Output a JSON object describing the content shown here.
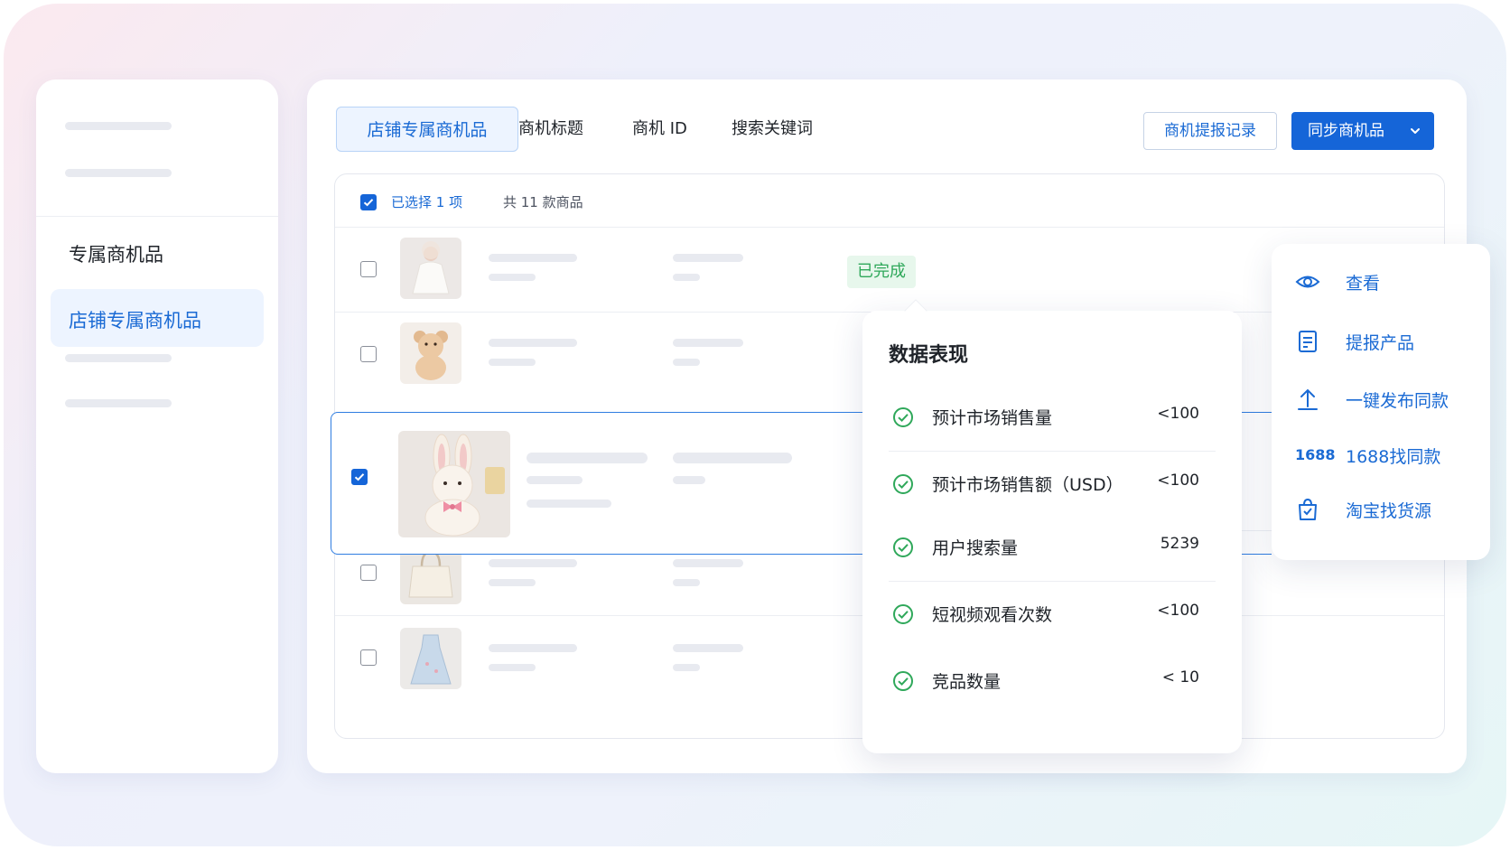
{
  "sidebar": {
    "heading": "专属商机品",
    "active_item": "店铺专属商机品"
  },
  "tabs": [
    {
      "label": "店铺专属商机品"
    },
    {
      "label": "商机标题"
    },
    {
      "label": "商机 ID"
    },
    {
      "label": "搜索关键词"
    }
  ],
  "actions": {
    "report_history": "商机提报记录",
    "sync": "同步商机品"
  },
  "table": {
    "selected_text": "已选择 1 项",
    "total_text": "共 11 款商品",
    "status_badge": "已完成"
  },
  "popover": {
    "title": "数据表现",
    "metrics": [
      {
        "label": "预计市场销售量",
        "value": "<100"
      },
      {
        "label": "预计市场销售额（USD）",
        "value": "<100"
      },
      {
        "label": "用户搜索量",
        "value": "5239"
      },
      {
        "label": "短视频观看次数",
        "value": "<100"
      },
      {
        "label": "竞品数量",
        "value": "< 10"
      }
    ]
  },
  "menu": {
    "items": [
      {
        "label": "查看",
        "icon": "eye-icon"
      },
      {
        "label": "提报产品",
        "icon": "document-icon"
      },
      {
        "label": "一键发布同款",
        "icon": "upload-icon"
      },
      {
        "label": "1688找同款",
        "icon": "1688-icon",
        "icon_text": "1688"
      },
      {
        "label": "淘宝找货源",
        "icon": "shopping-bag-icon"
      }
    ]
  },
  "colors": {
    "accent": "#1565d8",
    "success": "#2fa85a",
    "highlight_border": "#2f7de1"
  }
}
